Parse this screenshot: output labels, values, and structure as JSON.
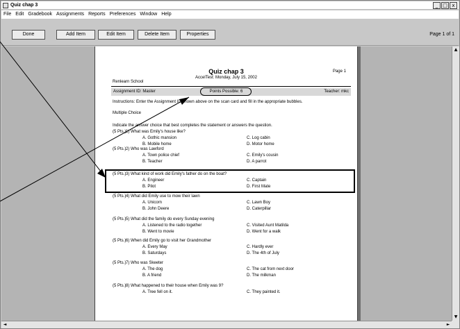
{
  "window": {
    "title": "Quiz chap 3",
    "controls": [
      "_",
      "□",
      "x"
    ]
  },
  "menu": [
    "File",
    "Edit",
    "Gradebook",
    "Assignments",
    "Reports",
    "Preferences",
    "Window",
    "Help"
  ],
  "toolbar": {
    "done": "Done",
    "add_item": "Add Item",
    "edit_item": "Edit Item",
    "delete_item": "Delete Item",
    "properties": "Properties",
    "page_count": "Page 1 of 1"
  },
  "scroll": {
    "up": "▲",
    "down": "▼",
    "left": "◄",
    "right": "►"
  },
  "page": {
    "title": "Quiz chap 3",
    "subtitle": "AccelTest: Monday, July 15, 2002",
    "page_label": "Page 1",
    "school": "Renlearn School",
    "assignment_id": "Assignment ID: Master",
    "points": "Points Possible: 6",
    "teacher": "Teacher: mkc",
    "instructions": "Instructions: Enter the Assignment ID shown above on the scan card and fill in the appropriate bubbles.",
    "section": "Multiple Choice",
    "directions": "Indicate the answer choice that best completes the statement or answers the question."
  },
  "questions": [
    {
      "pts": "(5 Pts.)",
      "stem": "1) What was Emily's house like?",
      "a": "A. Gothic mansion",
      "b": "B. Mobile home",
      "c": "C. Log cabin",
      "d": "D. Motor home"
    },
    {
      "pts": "(5 Pts.)",
      "stem": "2) Who was Lawford",
      "a": "A. Town police chief",
      "b": "B. Teacher",
      "c": "C. Emily's cousin",
      "d": "D. A parrot"
    },
    {
      "pts": "(5 Pts.)",
      "stem": "3) What kind of work did Emily's father do on the boat?",
      "a": "A. Engineer",
      "b": "B. Pilot",
      "c": "C. Captain",
      "d": "D. First Mate"
    },
    {
      "pts": "(5 Pts.)",
      "stem": "4) What did Emily use to mow their lawn",
      "a": "A. Unicorn",
      "b": "B. John Deere",
      "c": "C. Lawn Boy",
      "d": "D. Caterpillar"
    },
    {
      "pts": "(5 Pts.)",
      "stem": "5) What did the family do every Sunday evening",
      "a": "A. Listened to the radio together",
      "b": "B. Went to movie",
      "c": "C. Visited Aunt Matilda",
      "d": "D. Went for a walk"
    },
    {
      "pts": "(5 Pts.)",
      "stem": "6) When did Emily go to visit her Grandmother",
      "a": "A. Every May",
      "b": "B. Saturdays",
      "c": "C. Hardly ever",
      "d": "D. The 4th of July"
    },
    {
      "pts": "(5 Pts.)",
      "stem": "7) Who was Skeeter",
      "a": "A. The dog",
      "b": "B. A friend",
      "c": "C. The cat from next door",
      "d": "D. The milkman"
    },
    {
      "pts": "(5 Pts.)",
      "stem": "8) What happened to their house when Emily was 9?",
      "a": "A. Tree fell on it.",
      "b": "",
      "c": "C. They painted it.",
      "d": ""
    }
  ]
}
